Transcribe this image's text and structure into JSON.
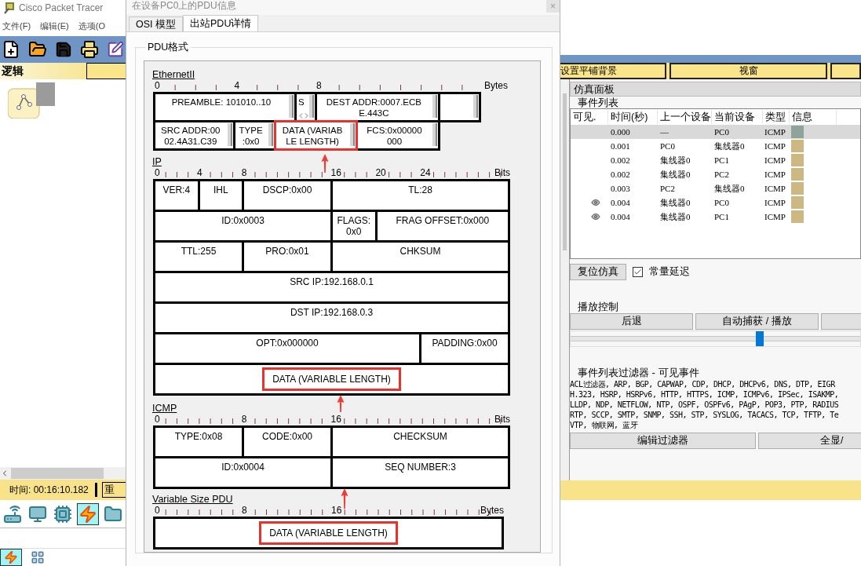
{
  "app": {
    "title": "Cisco Packet Tracer",
    "menu": [
      "文件(F)",
      "编辑(E)",
      "选项(O"
    ],
    "workspace_tab": "逻辑",
    "time_label": "时间: 00:16:10.182",
    "reset_button": "重",
    "devices": [
      {
        "selected": false
      },
      {
        "selected": false
      },
      {
        "selected": false
      },
      {
        "selected": true
      },
      {
        "selected": false
      }
    ],
    "sub_devices": [
      {
        "selected": true
      },
      {
        "selected": false
      }
    ]
  },
  "top_strip": {
    "buttons": [
      "设置平铺背景",
      "视窗"
    ]
  },
  "dialog": {
    "title": "在设备PC0上的PDU信息",
    "close": "×",
    "tabs": [
      {
        "label": "OSI 模型",
        "selected": false
      },
      {
        "label": "出站PDU详情",
        "selected": true
      }
    ],
    "group": "PDU格式",
    "sections": [
      {
        "title": "EthernetII",
        "ruler": [
          "0",
          "4",
          "8"
        ],
        "unit": "Bytes",
        "rows": [
          [
            {
              "kind": "field",
              "text": "PREAMBLE: 101010..10",
              "colspan": 7,
              "highlighted": false
            },
            {
              "kind": "scroll",
              "text": "S",
              "highlighted": false
            },
            {
              "kind": "field",
              "text": "DEST ADDR:0007.ECB\nE.443C",
              "colspan": 6,
              "highlighted": false
            },
            {
              "kind": "blank",
              "colspan": 2,
              "highlighted": false
            }
          ],
          [
            {
              "kind": "field",
              "text": "SRC ADDR:00\n02.4A31.C39",
              "colspan": 4,
              "highlighted": false
            },
            {
              "kind": "field",
              "text": "TYPE\n:0x0",
              "colspan": 2,
              "highlighted": false
            },
            {
              "kind": "field",
              "text": "DATA (VARIAB\nLE LENGTH)",
              "colspan": 4,
              "highlighted": true
            },
            {
              "kind": "field",
              "text": "FCS:0x00000\n000",
              "colspan": 4,
              "highlighted": false
            }
          ]
        ]
      },
      {
        "title": "IP",
        "ruler": [
          "0",
          "4",
          "8",
          "16",
          "20",
          "24"
        ],
        "unit": "Bits",
        "rows": [
          [
            {
              "text": "VER:4",
              "colspan": 4,
              "highlighted": false
            },
            {
              "text": "IHL",
              "colspan": 4,
              "highlighted": false
            },
            {
              "text": "DSCP:0x00",
              "colspan": 8,
              "highlighted": false
            },
            {
              "text": "TL:28",
              "colspan": 16,
              "highlighted": false
            }
          ],
          [
            {
              "text": "ID:0x0003",
              "colspan": 16,
              "highlighted": false
            },
            {
              "text": "FLAGS:\n0x0",
              "colspan": 4,
              "highlighted": false
            },
            {
              "text": "FRAG OFFSET:0x000",
              "colspan": 12,
              "highlighted": false
            }
          ],
          [
            {
              "text": "TTL:255",
              "colspan": 8,
              "highlighted": false
            },
            {
              "text": "PRO:0x01",
              "colspan": 8,
              "highlighted": false
            },
            {
              "text": "CHKSUM",
              "colspan": 16,
              "highlighted": false
            }
          ],
          [
            {
              "text": "SRC IP:192.168.0.1",
              "colspan": 32,
              "highlighted": false
            }
          ],
          [
            {
              "text": "DST IP:192.168.0.3",
              "colspan": 32,
              "highlighted": false
            }
          ],
          [
            {
              "text": "OPT:0x000000",
              "colspan": 24,
              "highlighted": false
            },
            {
              "text": "PADDING:0x00",
              "colspan": 8,
              "highlighted": false
            }
          ],
          [
            {
              "text": "DATA (VARIABLE LENGTH)",
              "colspan": 32,
              "highlighted": true
            }
          ]
        ]
      },
      {
        "title": "ICMP",
        "ruler": [
          "0",
          "8",
          "16"
        ],
        "unit": "Bits",
        "rows": [
          [
            {
              "text": "TYPE:0x08",
              "colspan": 8,
              "highlighted": false
            },
            {
              "text": "CODE:0x00",
              "colspan": 8,
              "highlighted": false
            },
            {
              "text": "CHECKSUM",
              "colspan": 16,
              "highlighted": false
            }
          ],
          [
            {
              "text": "ID:0x0004",
              "colspan": 16,
              "highlighted": false
            },
            {
              "text": "SEQ NUMBER:3",
              "colspan": 16,
              "highlighted": false
            }
          ]
        ]
      },
      {
        "title": "Variable Size PDU",
        "ruler": [
          "0",
          "8",
          "16"
        ],
        "unit": "Bytes",
        "rows": [
          [
            {
              "text": "DATA (VARIABLE LENGTH)",
              "colspan": 32,
              "highlighted": true
            }
          ]
        ]
      }
    ]
  },
  "sim_panel": {
    "title": "仿真面板",
    "event_list": {
      "legend": "事件列表",
      "columns": [
        "可见.",
        "时间(秒)",
        "上一个设备",
        "当前设备",
        "类型",
        "信息"
      ],
      "rows": [
        {
          "visible": false,
          "time": "0.000",
          "last": "—",
          "current": "PC0",
          "type": "ICMP",
          "color": "#8fa39a",
          "selected": true
        },
        {
          "visible": false,
          "time": "0.001",
          "last": "PC0",
          "current": "集线器0",
          "type": "ICMP",
          "color": "#cdb883",
          "selected": false
        },
        {
          "visible": false,
          "time": "0.002",
          "last": "集线器0",
          "current": "PC1",
          "type": "ICMP",
          "color": "#cdb883",
          "selected": false
        },
        {
          "visible": false,
          "time": "0.002",
          "last": "集线器0",
          "current": "PC2",
          "type": "ICMP",
          "color": "#cdb883",
          "selected": false
        },
        {
          "visible": false,
          "time": "0.003",
          "last": "PC2",
          "current": "集线器0",
          "type": "ICMP",
          "color": "#cdb883",
          "selected": false
        },
        {
          "visible": true,
          "time": "0.004",
          "last": "集线器0",
          "current": "PC0",
          "type": "ICMP",
          "color": "#cdb883",
          "selected": false
        },
        {
          "visible": true,
          "time": "0.004",
          "last": "集线器0",
          "current": "PC1",
          "type": "ICMP",
          "color": "#cdb883",
          "selected": false
        }
      ]
    },
    "reset": "复位仿真",
    "constant_delay": {
      "label": "常量延迟",
      "checked": true
    },
    "playback": {
      "legend": "播放控制",
      "buttons": [
        "后退",
        "自动捕获 / 播放"
      ],
      "level": 0.64
    },
    "filter": {
      "legend": "事件列表过滤器 - 可见事件",
      "lines": [
        "ACL过滤器, ARP, BGP, CAPWAP, CDP, DHCP, DHCPv6, DNS, DTP, EIGR",
        "H.323, HSRP, HSRPv6, HTTP, HTTPS, ICMP, ICMPv6, IPSec, ISAKMP,",
        "LLDP, NDP, NETFLOW, NTP, OSPF, OSPFv6, PAgP, POP3, PTP, RADIUS",
        "RTP, SCCP, SMTP, SNMP, SSH, STP, SYSLOG, TACACS, TCP, TFTP, Te",
        "VTP, 物联网, 蓝牙"
      ],
      "buttons": [
        "编辑过滤器",
        "全显/"
      ]
    }
  }
}
